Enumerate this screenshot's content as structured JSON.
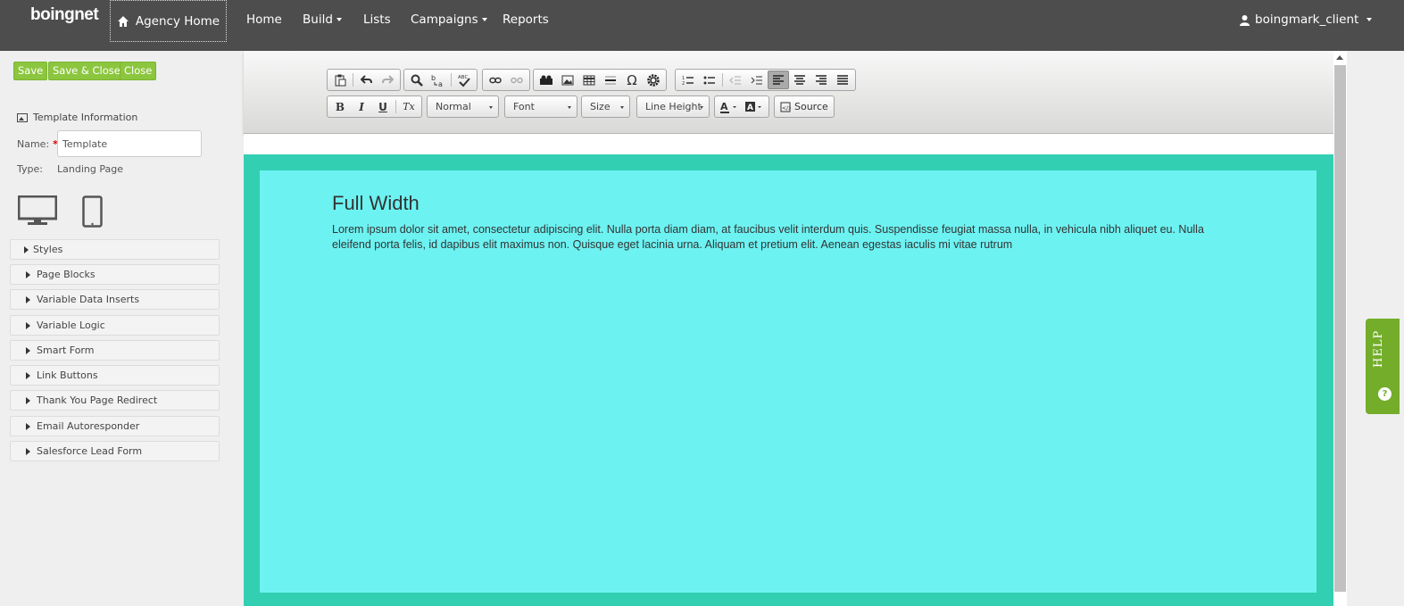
{
  "nav": {
    "logo": "boingnet",
    "agency_home": "Agency Home",
    "items": [
      "Home",
      "Build",
      "Lists",
      "Campaigns",
      "Reports"
    ],
    "user": "boingmark_client"
  },
  "sidebar": {
    "buttons": {
      "save": "Save",
      "save_close": "Save & Close",
      "close": "Close"
    },
    "template_info": "Template Information",
    "name_label": "Name:",
    "required_mark": "*",
    "name_value": "Template",
    "type_label": "Type:",
    "type_value": "Landing Page",
    "sections": [
      "Styles",
      "Page Blocks",
      "Variable Data Inserts",
      "Variable Logic",
      "Smart Form",
      "Link Buttons",
      "Thank You Page Redirect",
      "Email Autoresponder",
      "Salesforce Lead Form"
    ]
  },
  "toolbar": {
    "format": "Normal",
    "font": "Font",
    "size": "Size",
    "line_height": "Line Height",
    "source": "Source",
    "omega": "Ω",
    "bold": "B",
    "italic": "I",
    "underline": "U",
    "clear": "Tx"
  },
  "canvas": {
    "title": "Full Width",
    "body": "Lorem ipsum dolor sit amet, consectetur adipiscing elit. Nulla porta diam diam, at faucibus velit interdum quis. Suspendisse feugiat massa nulla, in vehicula nibh aliquet eu. Nulla eleifend porta felis, id dapibus elit maximus non. Quisque eget lacinia urna. Aliquam et pretium elit. Aenean egestas iaculis mi vitae rutrum"
  },
  "help": {
    "label": "HELP",
    "icon_glyph": "?"
  },
  "colors": {
    "nav_bg": "#4d4d4d",
    "green": "#8cc63f",
    "canvas_outer": "#33cfb2",
    "canvas_inner": "#6df2f2",
    "help_bg": "#73ad2a"
  }
}
